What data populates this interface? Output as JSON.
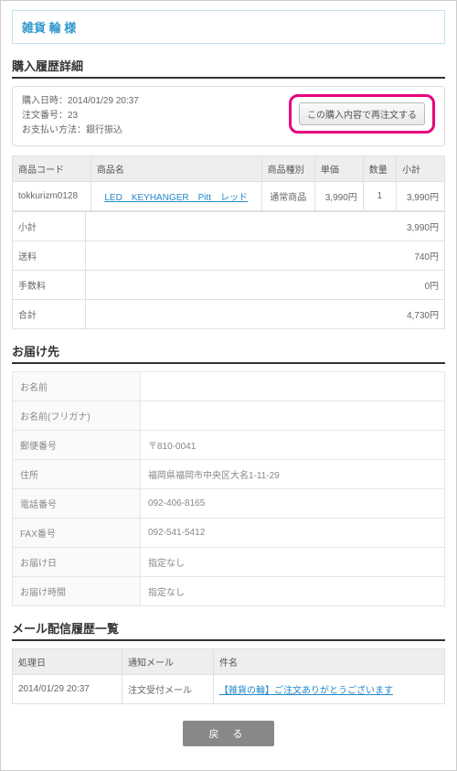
{
  "store_name": "雑貨 輪 様",
  "sections": {
    "history": "購入履歴詳細",
    "delivery": "お届け先",
    "mail": "メール配信履歴一覧"
  },
  "meta": {
    "datetime_label": "購入日時：",
    "datetime": "2014/01/29 20:37",
    "order_no_label": "注文番号：",
    "order_no": "23",
    "payment_label": "お支払い方法：",
    "payment": "銀行振込"
  },
  "reorder_button": "この購入内容で再注文する",
  "product_headers": {
    "code": "商品コード",
    "name": "商品名",
    "type": "商品種別",
    "price": "単価",
    "qty": "数量",
    "subtotal": "小計"
  },
  "products": [
    {
      "code": "tokkurizm0128",
      "name": "LED　KEYHANGER　Pitt　レッド",
      "type": "通常商品",
      "price": "3,990円",
      "qty": "1",
      "subtotal": "3,990円"
    }
  ],
  "totals": {
    "subtotal_label": "小計",
    "subtotal": "3,990円",
    "shipping_label": "送料",
    "shipping": "740円",
    "fee_label": "手数料",
    "fee": "0円",
    "total_label": "合計",
    "total": "4,730円"
  },
  "delivery": {
    "name_label": "お名前",
    "name": "",
    "kana_label": "お名前(フリガナ)",
    "kana": "",
    "zip_label": "郵便番号",
    "zip": "〒810-0041",
    "address_label": "住所",
    "address": "福岡県福岡市中央区大名1-11-29",
    "tel_label": "電話番号",
    "tel": "092-406-8165",
    "fax_label": "FAX番号",
    "fax": "092-541-5412",
    "date_label": "お届け日",
    "date": "指定なし",
    "time_label": "お届け時間",
    "time": "指定なし"
  },
  "mail_headers": {
    "date": "処理日",
    "type": "通知メール",
    "subject": "件名"
  },
  "mails": [
    {
      "date": "2014/01/29 20:37",
      "type": "注文受付メール",
      "subject": "【雑貨の輪】ご注文ありがとうございます"
    }
  ],
  "back_button": "戻 る"
}
